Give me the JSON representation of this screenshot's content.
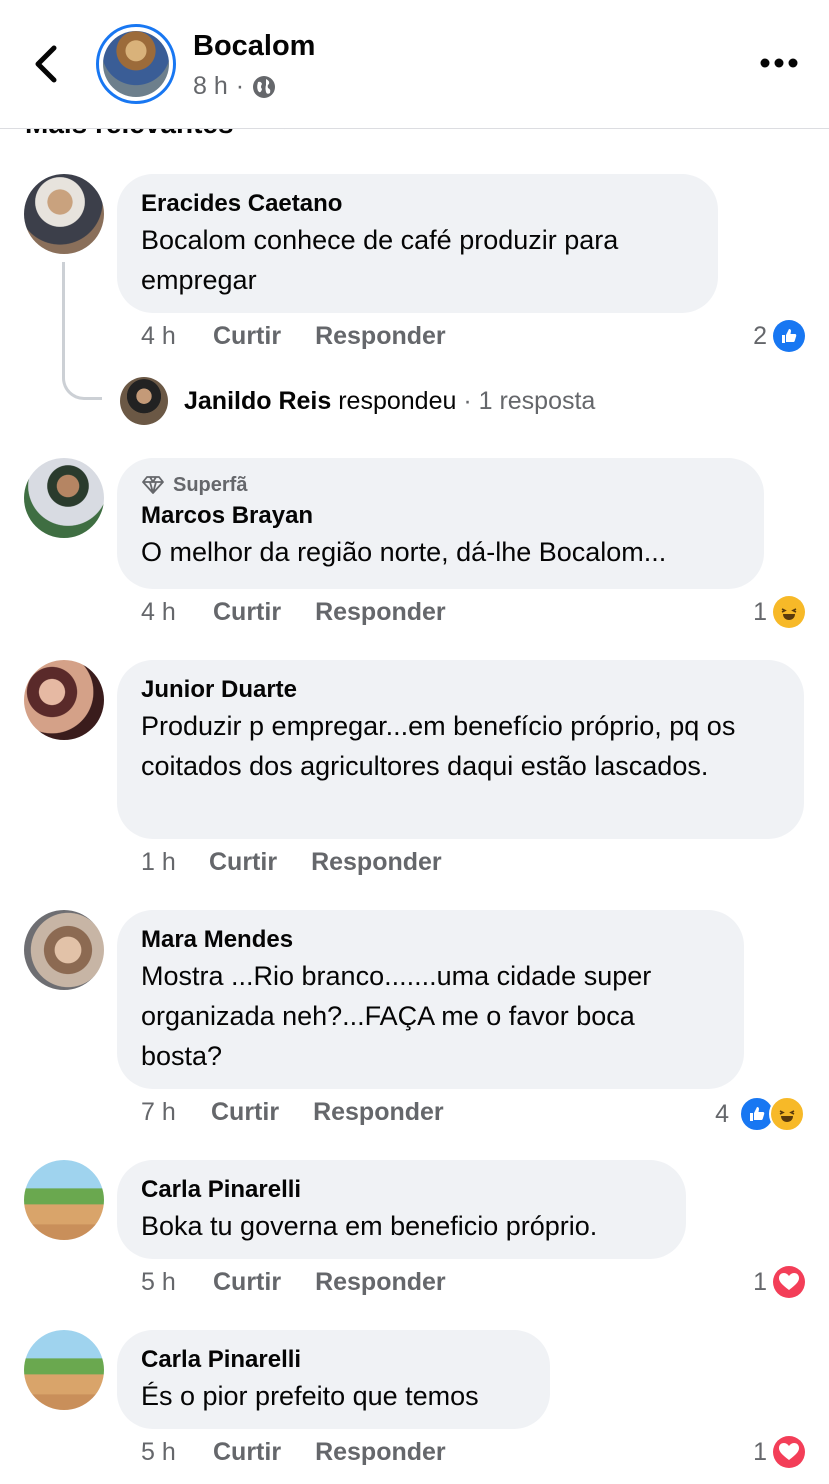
{
  "header": {
    "page_name": "Bocalom",
    "time": "8 h",
    "separator": "·",
    "privacy_icon": "globe-icon"
  },
  "sort": {
    "label": "Mais relevantes"
  },
  "comments": [
    {
      "author": "Eracides Caetano",
      "text": "Bocalom conhece de café  produzir para empregar",
      "time": "4 h",
      "like_label": "Curtir",
      "reply_label": "Responder",
      "reaction_count": "2",
      "reactions": [
        "like"
      ],
      "reply_preview": {
        "author": "Janildo Reis",
        "verb": "respondeu",
        "count": "· 1 resposta"
      }
    },
    {
      "badge": "Superfã",
      "author": "Marcos Brayan",
      "text": "O melhor da região norte, dá-lhe Bocalom...",
      "time": "4 h",
      "like_label": "Curtir",
      "reply_label": "Responder",
      "reaction_count": "1",
      "reactions": [
        "haha"
      ]
    },
    {
      "author": "Junior Duarte",
      "text": "Produzir p empregar...em benefício próprio, pq os coitados dos agricultores daqui estão lascados.",
      "time": "1 h",
      "like_label": "Curtir",
      "reply_label": "Responder"
    },
    {
      "author": "Mara Mendes",
      "text": "Mostra ...Rio branco.......uma cidade super organizada  neh?...FAÇA  me o favor boca bosta?",
      "time": "7 h",
      "like_label": "Curtir",
      "reply_label": "Responder",
      "reaction_count": "4",
      "reactions": [
        "like",
        "haha"
      ]
    },
    {
      "author": "Carla Pinarelli",
      "text": "Boka tu governa em beneficio próprio.",
      "time": "5 h",
      "like_label": "Curtir",
      "reply_label": "Responder",
      "reaction_count": "1",
      "reactions": [
        "love"
      ]
    },
    {
      "author": "Carla Pinarelli",
      "text": "És o pior prefeito que temos",
      "time": "5 h",
      "like_label": "Curtir",
      "reply_label": "Responder",
      "reaction_count": "1",
      "reactions": [
        "love"
      ]
    }
  ],
  "colors": {
    "accent": "#1877f2",
    "bubble": "#f0f2f5",
    "secondary_text": "#65676b",
    "haha": "#f7b928",
    "love": "#f33e58"
  }
}
